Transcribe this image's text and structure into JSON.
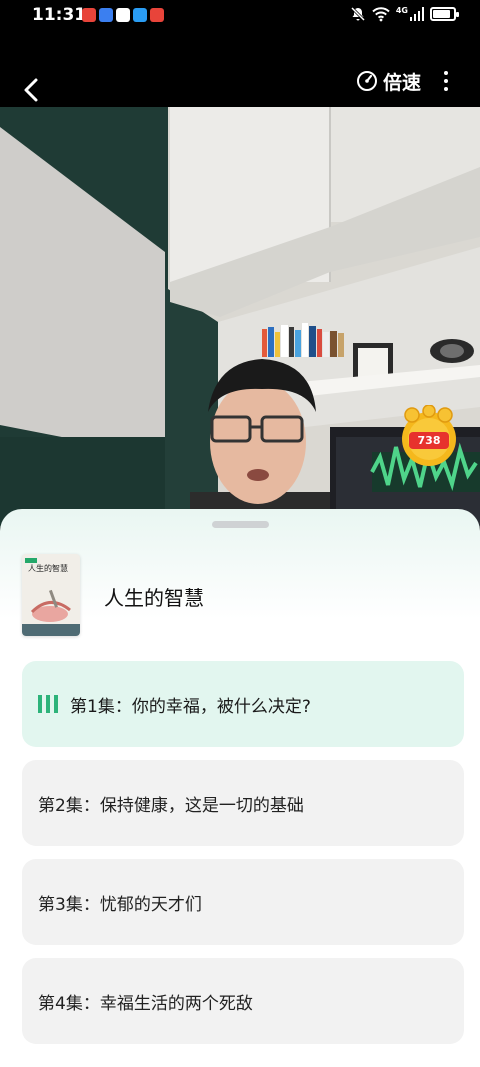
{
  "status_bar": {
    "time": "11:31",
    "network": "4G",
    "battery_level": 0.85
  },
  "top_bar": {
    "speed_label": "倍速"
  },
  "video": {
    "coin_count": "738"
  },
  "album": {
    "title": "人生的智慧",
    "cover_title": "人生的智慧"
  },
  "episodes": [
    {
      "label": "第1集：你的幸福，被什么决定?",
      "playing": true
    },
    {
      "label": "第2集：保持健康，这是一切的基础",
      "playing": false
    },
    {
      "label": "第3集：忧郁的天才们",
      "playing": false
    },
    {
      "label": "第4集：幸福生活的两个死敌",
      "playing": false
    }
  ],
  "colors": {
    "accent": "#2db37a",
    "active_row": "#e2f6ef",
    "row": "#f2f2f2",
    "coin_red": "#e7322d"
  },
  "icons": [
    "back-arrow-icon",
    "speed-dial-icon",
    "more-vertical-icon",
    "playing-bars-icon",
    "gold-coin-icon",
    "mute-icon",
    "wifi-icon",
    "signal-icon",
    "battery-icon"
  ]
}
